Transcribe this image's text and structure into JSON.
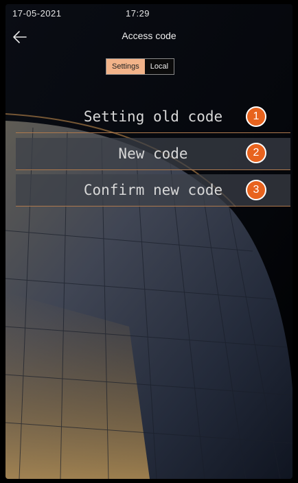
{
  "status_bar": {
    "date": "17-05-2021",
    "time": "17:29"
  },
  "header": {
    "title": "Access code",
    "back_icon": "arrow-left-icon"
  },
  "tabs": [
    {
      "label": "Settings",
      "active": true
    },
    {
      "label": "Local",
      "active": false
    }
  ],
  "fields": [
    {
      "label": "Setting old code",
      "badge": "1"
    },
    {
      "label": "New code",
      "badge": "2"
    },
    {
      "label": "Confirm new code",
      "badge": "3"
    }
  ],
  "colors": {
    "accent": "#f2b389",
    "badge": "#e8631e",
    "divider": "#b07a4e"
  }
}
